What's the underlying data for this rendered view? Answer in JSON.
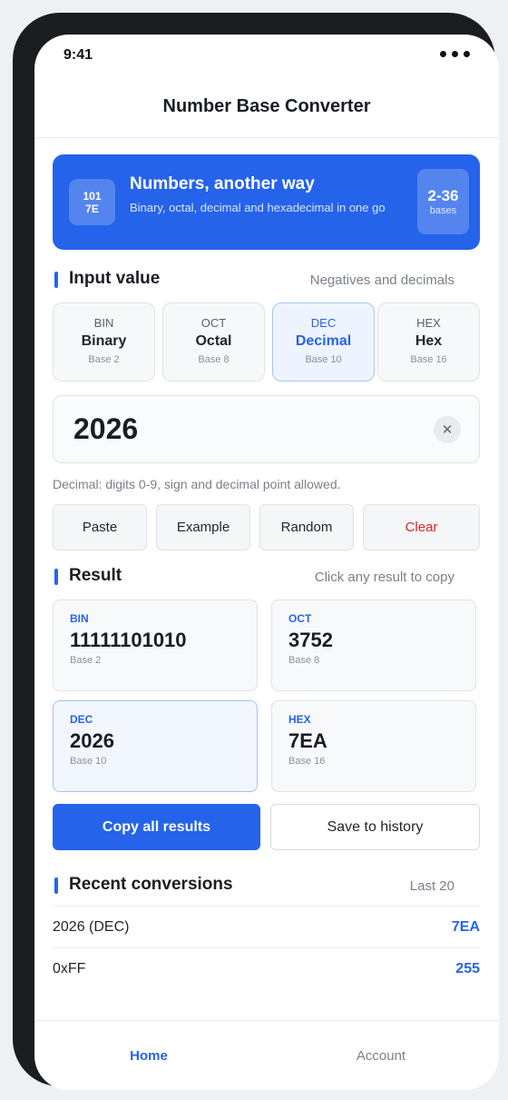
{
  "status_bar": {
    "time": "9:41"
  },
  "app_title": "Number Base Converter",
  "hero": {
    "logo_line1": "101",
    "logo_line2": "7E",
    "title": "Numbers, another way",
    "subtitle": "Binary, octal, decimal and hexadecimal in one go",
    "badge_value": "2-36",
    "badge_label": "bases"
  },
  "input_section": {
    "title": "Input value",
    "hint": "Negatives and decimals",
    "bases": [
      {
        "code": "BIN",
        "name": "Binary",
        "sub": "Base 2"
      },
      {
        "code": "OCT",
        "name": "Octal",
        "sub": "Base 8"
      },
      {
        "code": "DEC",
        "name": "Decimal",
        "sub": "Base 10"
      },
      {
        "code": "HEX",
        "name": "Hex",
        "sub": "Base 16"
      }
    ],
    "selected_base": "DEC",
    "value": "2026",
    "helper": "Decimal: digits 0-9, sign and decimal point allowed.",
    "actions": {
      "paste": "Paste",
      "example": "Example",
      "random": "Random",
      "clear": "Clear"
    }
  },
  "result_section": {
    "title": "Result",
    "hint": "Click any result to copy",
    "items": [
      {
        "code": "BIN",
        "value": "11111101010",
        "sub": "Base 2"
      },
      {
        "code": "OCT",
        "value": "3752",
        "sub": "Base 8"
      },
      {
        "code": "DEC",
        "value": "2026",
        "sub": "Base 10"
      },
      {
        "code": "HEX",
        "value": "7EA",
        "sub": "Base 16"
      }
    ],
    "copy_all": "Copy all results",
    "save_history": "Save to history"
  },
  "history": {
    "title": "Recent conversions",
    "hint": "Last 20",
    "rows": [
      {
        "input": "2026 (DEC)",
        "output": "7EA"
      },
      {
        "input": "0xFF",
        "output": "255"
      }
    ]
  },
  "tabbar": {
    "home": "Home",
    "account": "Account"
  },
  "colors": {
    "accent": "#2563eb",
    "danger": "#dc2626"
  }
}
